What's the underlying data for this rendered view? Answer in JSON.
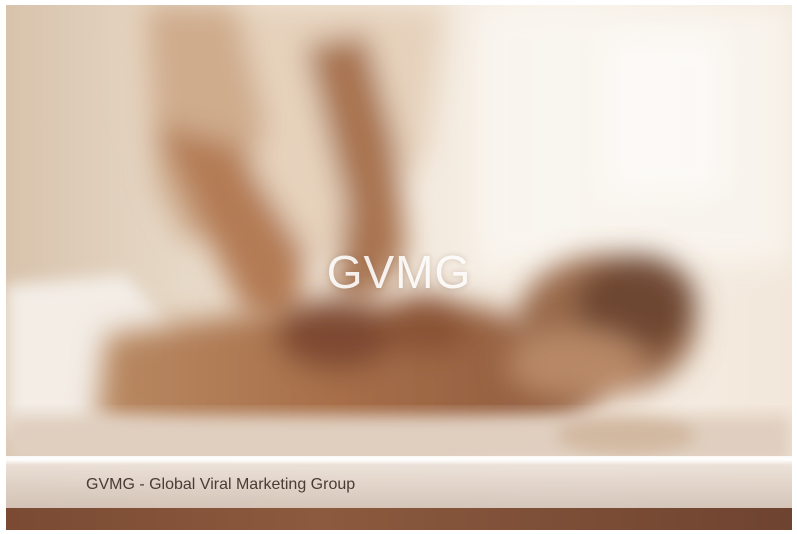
{
  "hero": {
    "title": "GVMG",
    "caption": "GVMG - Global Viral Marketing Group"
  },
  "colors": {
    "caption_text": "#4a3b35",
    "title_text": "#ffffff",
    "warm_background": "#e9dccb",
    "bottom_strip": "#7a4a33"
  }
}
